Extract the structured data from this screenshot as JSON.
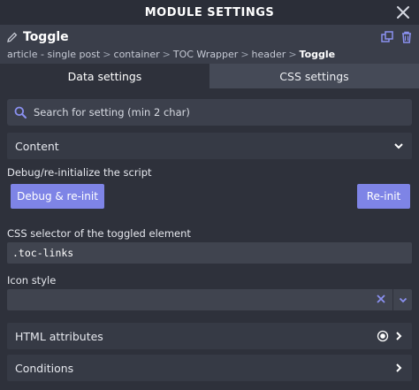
{
  "window": {
    "title": "MODULE SETTINGS"
  },
  "module": {
    "name": "Toggle"
  },
  "breadcrumb": {
    "items": [
      "article - single post",
      "container",
      "TOC Wrapper",
      "header"
    ],
    "current": "Toggle",
    "separator": ">"
  },
  "tabs": [
    {
      "label": "Data settings",
      "active": true
    },
    {
      "label": "CSS settings",
      "active": false
    }
  ],
  "search": {
    "placeholder": "Search for setting (min 2 char)"
  },
  "groups": {
    "content": {
      "label": "Content"
    },
    "html_attributes": {
      "label": "HTML attributes"
    },
    "conditions": {
      "label": "Conditions"
    }
  },
  "fields": {
    "debug": {
      "label": "Debug/re-initialize the script",
      "debug_button": "Debug & re-init",
      "reinit_button": "Re-init"
    },
    "css_selector": {
      "label": "CSS selector of the toggled element",
      "value": ".toc-links"
    },
    "icon_style": {
      "label": "Icon style",
      "value": ""
    }
  },
  "colors": {
    "accent": "#7e84e6",
    "panel_bg": "#2e313b",
    "header_bg": "#3a3e4a",
    "titlebar_bg": "#2b2e38"
  }
}
